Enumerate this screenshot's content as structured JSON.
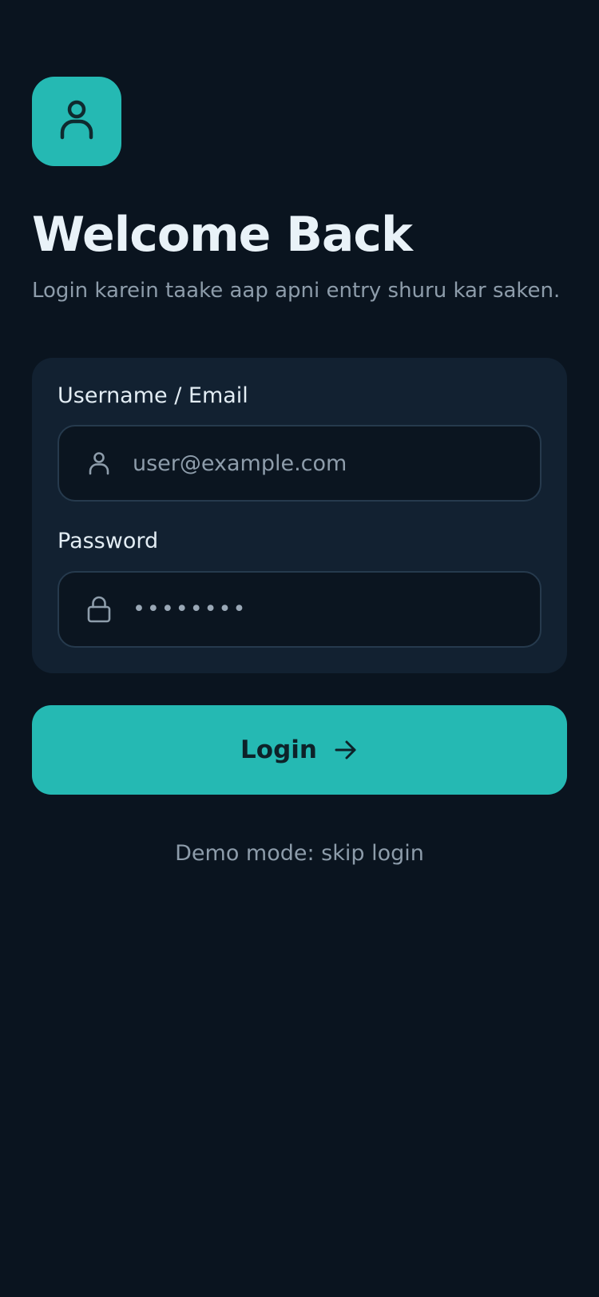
{
  "header": {
    "logo_icon": "user-icon",
    "title": "Welcome Back",
    "subtitle": "Login karein taake aap apni entry shuru kar saken."
  },
  "form": {
    "username": {
      "label": "Username / Email",
      "icon": "user-icon",
      "placeholder": "user@example.com",
      "value": ""
    },
    "password": {
      "label": "Password",
      "icon": "lock-icon",
      "value": "••••••••"
    }
  },
  "actions": {
    "login_label": "Login",
    "login_icon": "arrow-right-icon",
    "skip_label": "Demo mode: skip login"
  },
  "colors": {
    "background": "#0a141f",
    "card": "#122131",
    "accent": "#25b9b3",
    "text_primary": "#e9f2f8",
    "text_secondary": "#8d9caa"
  }
}
